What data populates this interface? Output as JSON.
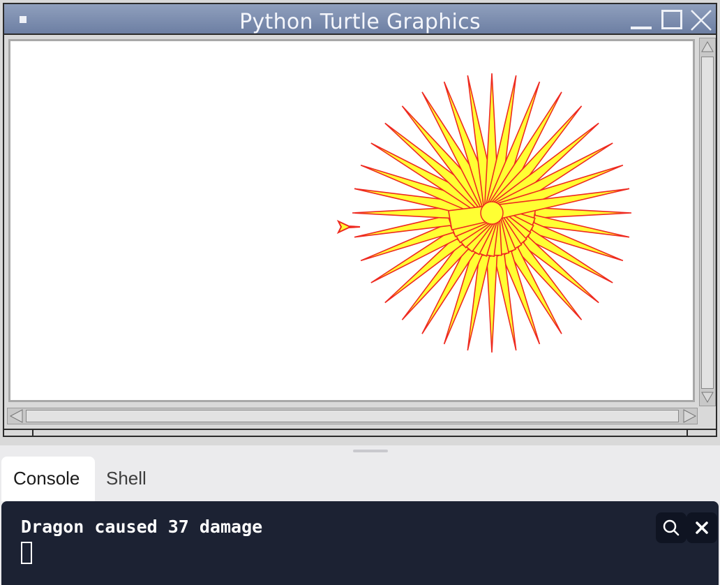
{
  "window": {
    "title": "Python Turtle Graphics"
  },
  "turtle_canvas": {
    "background": "#ffffff",
    "star_fill_color": "#ffff33",
    "star_stroke_color": "#ee2a20",
    "star_points": 36
  },
  "panel": {
    "tabs": [
      {
        "label": "Console",
        "active": true
      },
      {
        "label": "Shell",
        "active": false
      }
    ]
  },
  "console": {
    "output_line": "Dragon caused 37 damage",
    "background": "#1c2233"
  },
  "icons": {
    "window_menu": "window-menu-icon",
    "minimize": "minimize-icon",
    "maximize": "maximize-icon",
    "close": "close-icon",
    "search": "search-icon",
    "console_close": "close-icon"
  }
}
